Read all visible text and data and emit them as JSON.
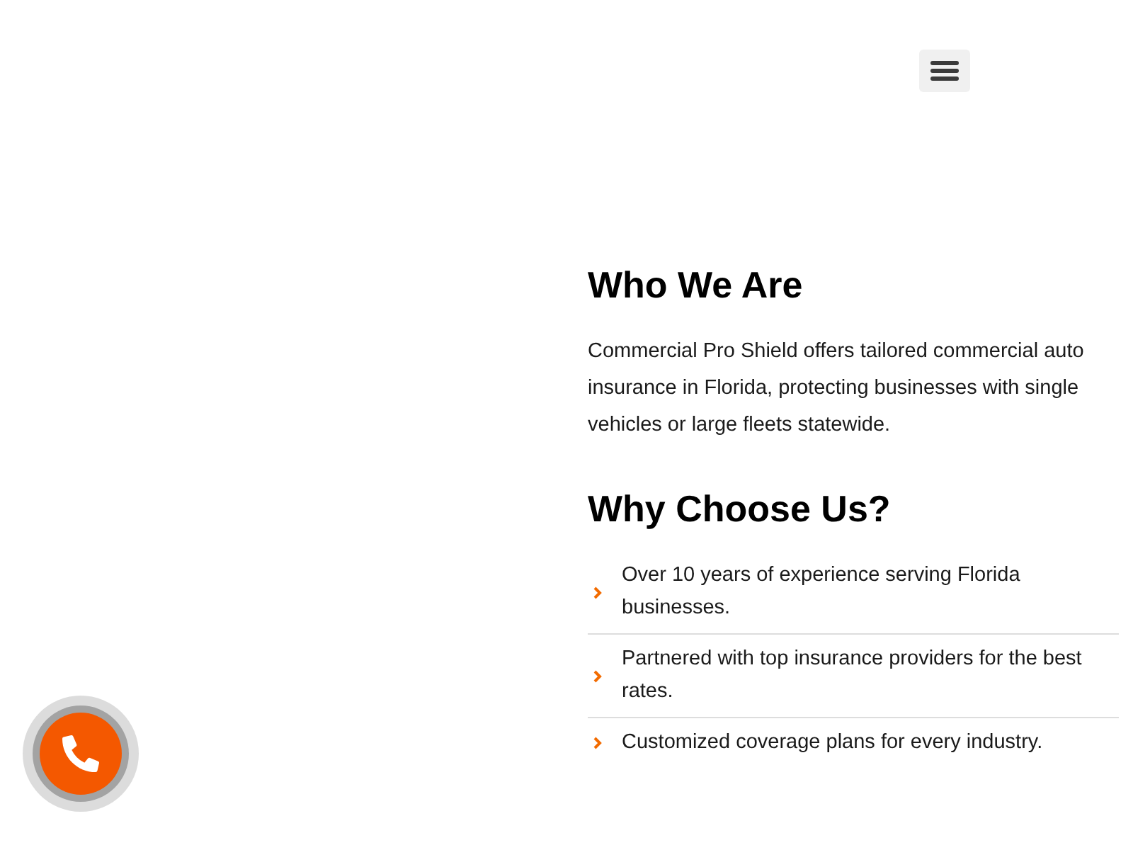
{
  "about": {
    "heading": "Who We Are",
    "text": "Commercial Pro Shield offers tailored commercial auto insurance in Florida, protecting businesses with single vehicles or large fleets statewide."
  },
  "why_choose_us": {
    "heading": "Why Choose Us?",
    "items": [
      "Over 10 years of experience serving Florida businesses.",
      "Partnered with top insurance providers for the best rates.",
      "Customized coverage plans for every industry."
    ]
  }
}
